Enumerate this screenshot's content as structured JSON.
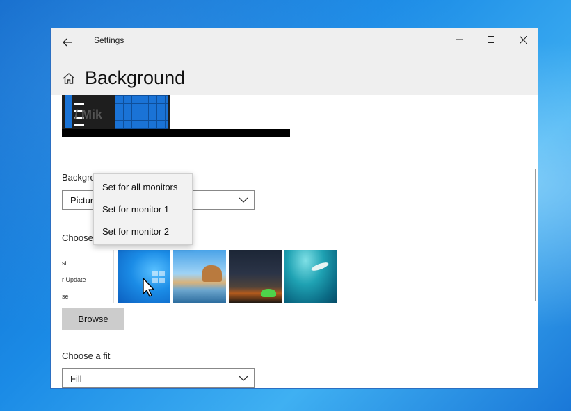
{
  "window": {
    "app_title": "Settings",
    "page_title": "Background",
    "icons": {
      "back": "back-arrow-icon",
      "minimize": "minimize-icon",
      "maximize": "maximize-icon",
      "close": "close-icon",
      "home": "home-icon"
    }
  },
  "preview": {
    "partial_text": "/ Mik"
  },
  "background": {
    "label": "Backgro",
    "dropdown_value": "Pictur"
  },
  "context_menu": {
    "items": [
      "Set for all monitors",
      "Set for monitor 1",
      "Set for monitor 2"
    ]
  },
  "choose_picture": {
    "label": "Choose",
    "strip_items": [
      "st",
      "r Update",
      "se"
    ]
  },
  "browse": {
    "label": "Browse"
  },
  "fit": {
    "label": "Choose a fit",
    "dropdown_value": "Fill"
  },
  "colors": {
    "accent": "#0078d7",
    "titlebar": "#efefef",
    "button": "#cccccc"
  }
}
